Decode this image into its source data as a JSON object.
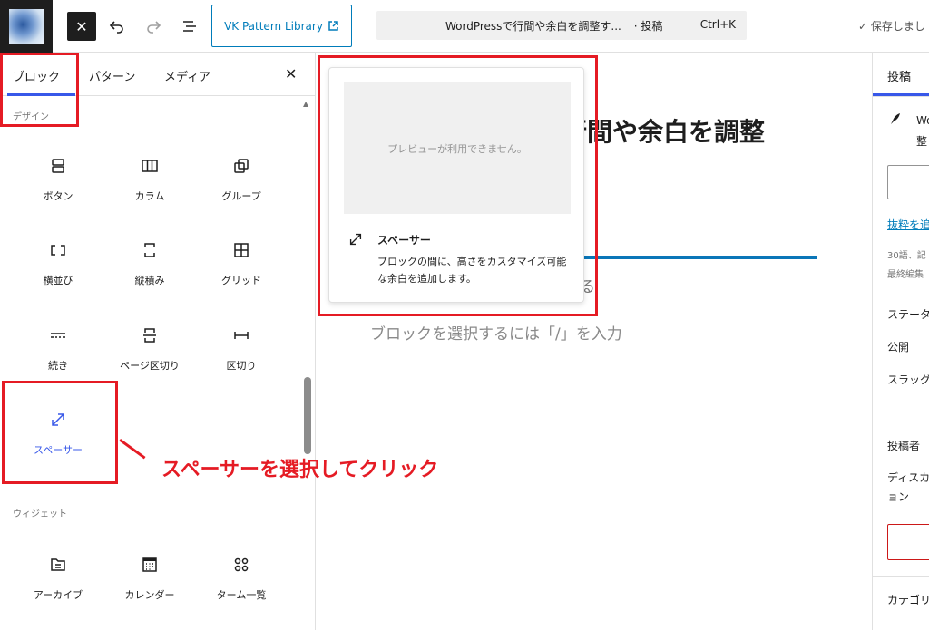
{
  "topbar": {
    "close_icon": "close-icon",
    "vk_button_label": "VK Pattern Library",
    "command_title": "WordPressで行間や余白を調整す...",
    "command_type": "· 投稿",
    "command_shortcut": "Ctrl+K",
    "saved_label": "保存しまし"
  },
  "inserter": {
    "tabs": {
      "blocks": "ブロック",
      "patterns": "パターン",
      "media": "メディア"
    },
    "design_category": "デザイン",
    "widget_category": "ウィジェット",
    "design_blocks": [
      {
        "label": "ボタン",
        "icon": "buttons-icon"
      },
      {
        "label": "カラム",
        "icon": "columns-icon"
      },
      {
        "label": "グループ",
        "icon": "group-icon"
      },
      {
        "label": "横並び",
        "icon": "row-icon"
      },
      {
        "label": "縦積み",
        "icon": "stack-icon"
      },
      {
        "label": "グリッド",
        "icon": "grid-icon"
      },
      {
        "label": "続き",
        "icon": "more-icon"
      },
      {
        "label": "ページ区切り",
        "icon": "page-break-icon"
      },
      {
        "label": "区切り",
        "icon": "separator-icon"
      },
      {
        "label": "スペーサー",
        "icon": "spacer-icon",
        "selected": true
      }
    ],
    "widget_blocks": [
      {
        "label": "アーカイブ",
        "icon": "archive-icon"
      },
      {
        "label": "カレンダー",
        "icon": "calendar-icon"
      },
      {
        "label": "ターム一覧",
        "icon": "terms-list-icon"
      }
    ]
  },
  "canvas": {
    "title_fragment": "行間や余白を調整",
    "paragraph_fragment": "る",
    "block_prompt": "ブロックを選択するには「/」を入力"
  },
  "preview": {
    "unavailable": "プレビューが利用できません。",
    "block_name": "スペーサー",
    "block_description": "ブロックの間に、高さをカスタマイズ可能な余白を追加します。"
  },
  "sidebar": {
    "tab_post": "投稿",
    "title_fragment_1": "Wo",
    "title_fragment_2": "整",
    "excerpt_link": "抜粋を追",
    "stats_line_1": "30語、記",
    "stats_line_2": "最終編集",
    "status_label": "ステータ",
    "publish_label": "公開",
    "slug_label": "スラッグ",
    "author_label": "投稿者",
    "discussion_label_1": "ディスカ",
    "discussion_label_2": "ョン",
    "categories_label": "カテゴリ"
  },
  "annotation": {
    "callout": "スペーサーを選択してクリック",
    "color": "#e51b24"
  },
  "colors": {
    "accent": "#3858e9",
    "link": "#007cba"
  }
}
